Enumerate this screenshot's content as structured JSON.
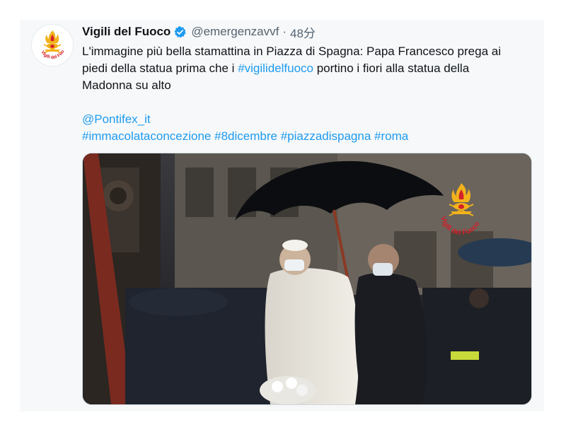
{
  "tweet": {
    "author_name": "Vigili del Fuoco",
    "handle": "@emergenzavvf",
    "separator": "·",
    "time": "48分",
    "text_line1": "L'immagine più bella stamattina in Piazza di Spagna: Papa Francesco prega ai",
    "text_line2_pre": "piedi della statua prima che i ",
    "text_line2_hashtag": "#vigilidelfuoco",
    "text_line2_post": " portino i fiori alla statua della",
    "text_line3": "Madonna su alto",
    "mention": "@Pontifex_it",
    "hashtags": [
      "#immacolataconcezione",
      "#8dicembre",
      "#piazzadispagna",
      "#roma"
    ],
    "verified_icon": "verified-badge-icon",
    "avatar_icon": "vigili-del-fuoco-emblem-icon",
    "avatar_text": "Vigili del Fuoco",
    "watermark_text": "Vigili del Fuoco"
  },
  "colors": {
    "link": "#1d9bf0",
    "name": "#0f1419",
    "secondary": "#536471",
    "emblem_red": "#d3202a",
    "emblem_gold": "#f2b21b"
  }
}
